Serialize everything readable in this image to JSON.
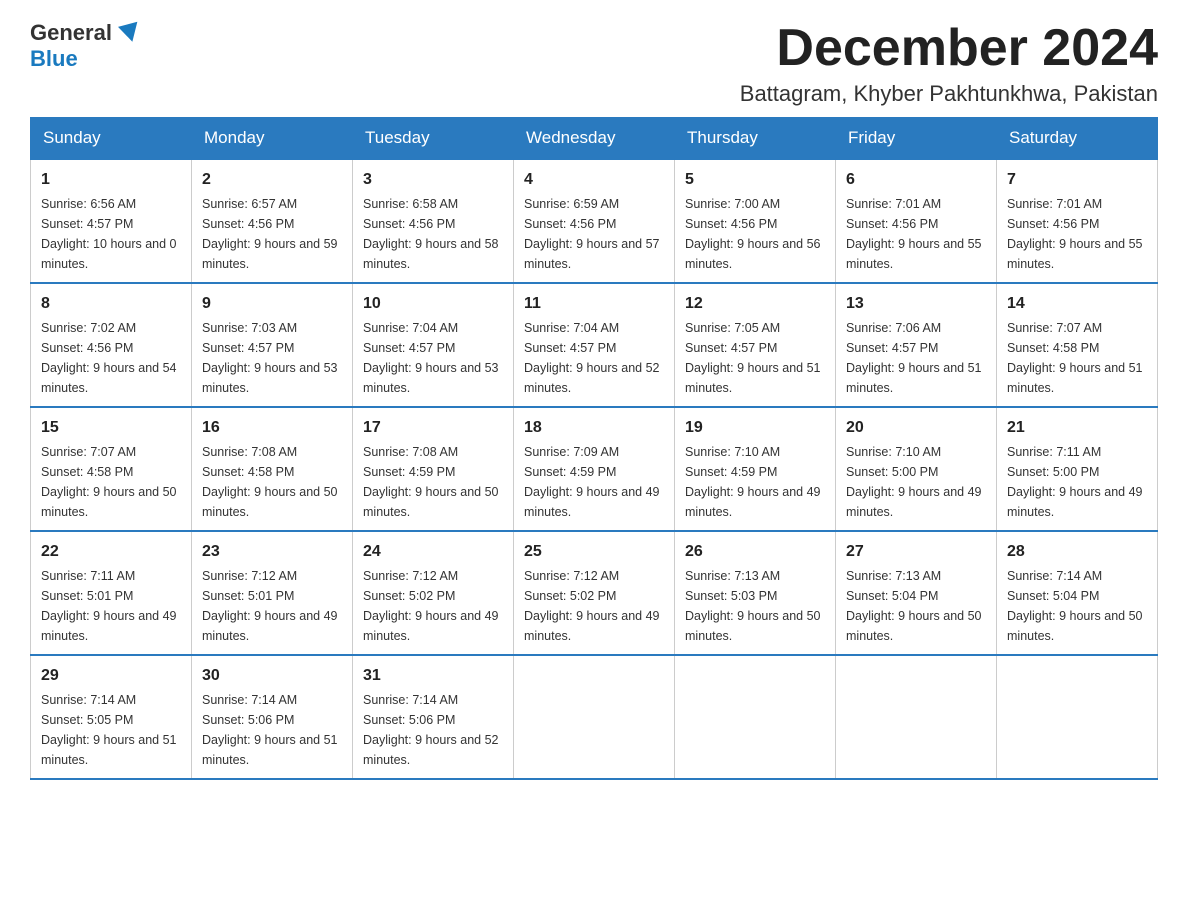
{
  "header": {
    "logo_general": "General",
    "logo_blue": "Blue",
    "title": "December 2024",
    "subtitle": "Battagram, Khyber Pakhtunkhwa, Pakistan"
  },
  "weekdays": [
    "Sunday",
    "Monday",
    "Tuesday",
    "Wednesday",
    "Thursday",
    "Friday",
    "Saturday"
  ],
  "weeks": [
    [
      {
        "day": "1",
        "sunrise": "6:56 AM",
        "sunset": "4:57 PM",
        "daylight": "10 hours and 0 minutes."
      },
      {
        "day": "2",
        "sunrise": "6:57 AM",
        "sunset": "4:56 PM",
        "daylight": "9 hours and 59 minutes."
      },
      {
        "day": "3",
        "sunrise": "6:58 AM",
        "sunset": "4:56 PM",
        "daylight": "9 hours and 58 minutes."
      },
      {
        "day": "4",
        "sunrise": "6:59 AM",
        "sunset": "4:56 PM",
        "daylight": "9 hours and 57 minutes."
      },
      {
        "day": "5",
        "sunrise": "7:00 AM",
        "sunset": "4:56 PM",
        "daylight": "9 hours and 56 minutes."
      },
      {
        "day": "6",
        "sunrise": "7:01 AM",
        "sunset": "4:56 PM",
        "daylight": "9 hours and 55 minutes."
      },
      {
        "day": "7",
        "sunrise": "7:01 AM",
        "sunset": "4:56 PM",
        "daylight": "9 hours and 55 minutes."
      }
    ],
    [
      {
        "day": "8",
        "sunrise": "7:02 AM",
        "sunset": "4:56 PM",
        "daylight": "9 hours and 54 minutes."
      },
      {
        "day": "9",
        "sunrise": "7:03 AM",
        "sunset": "4:57 PM",
        "daylight": "9 hours and 53 minutes."
      },
      {
        "day": "10",
        "sunrise": "7:04 AM",
        "sunset": "4:57 PM",
        "daylight": "9 hours and 53 minutes."
      },
      {
        "day": "11",
        "sunrise": "7:04 AM",
        "sunset": "4:57 PM",
        "daylight": "9 hours and 52 minutes."
      },
      {
        "day": "12",
        "sunrise": "7:05 AM",
        "sunset": "4:57 PM",
        "daylight": "9 hours and 51 minutes."
      },
      {
        "day": "13",
        "sunrise": "7:06 AM",
        "sunset": "4:57 PM",
        "daylight": "9 hours and 51 minutes."
      },
      {
        "day": "14",
        "sunrise": "7:07 AM",
        "sunset": "4:58 PM",
        "daylight": "9 hours and 51 minutes."
      }
    ],
    [
      {
        "day": "15",
        "sunrise": "7:07 AM",
        "sunset": "4:58 PM",
        "daylight": "9 hours and 50 minutes."
      },
      {
        "day": "16",
        "sunrise": "7:08 AM",
        "sunset": "4:58 PM",
        "daylight": "9 hours and 50 minutes."
      },
      {
        "day": "17",
        "sunrise": "7:08 AM",
        "sunset": "4:59 PM",
        "daylight": "9 hours and 50 minutes."
      },
      {
        "day": "18",
        "sunrise": "7:09 AM",
        "sunset": "4:59 PM",
        "daylight": "9 hours and 49 minutes."
      },
      {
        "day": "19",
        "sunrise": "7:10 AM",
        "sunset": "4:59 PM",
        "daylight": "9 hours and 49 minutes."
      },
      {
        "day": "20",
        "sunrise": "7:10 AM",
        "sunset": "5:00 PM",
        "daylight": "9 hours and 49 minutes."
      },
      {
        "day": "21",
        "sunrise": "7:11 AM",
        "sunset": "5:00 PM",
        "daylight": "9 hours and 49 minutes."
      }
    ],
    [
      {
        "day": "22",
        "sunrise": "7:11 AM",
        "sunset": "5:01 PM",
        "daylight": "9 hours and 49 minutes."
      },
      {
        "day": "23",
        "sunrise": "7:12 AM",
        "sunset": "5:01 PM",
        "daylight": "9 hours and 49 minutes."
      },
      {
        "day": "24",
        "sunrise": "7:12 AM",
        "sunset": "5:02 PM",
        "daylight": "9 hours and 49 minutes."
      },
      {
        "day": "25",
        "sunrise": "7:12 AM",
        "sunset": "5:02 PM",
        "daylight": "9 hours and 49 minutes."
      },
      {
        "day": "26",
        "sunrise": "7:13 AM",
        "sunset": "5:03 PM",
        "daylight": "9 hours and 50 minutes."
      },
      {
        "day": "27",
        "sunrise": "7:13 AM",
        "sunset": "5:04 PM",
        "daylight": "9 hours and 50 minutes."
      },
      {
        "day": "28",
        "sunrise": "7:14 AM",
        "sunset": "5:04 PM",
        "daylight": "9 hours and 50 minutes."
      }
    ],
    [
      {
        "day": "29",
        "sunrise": "7:14 AM",
        "sunset": "5:05 PM",
        "daylight": "9 hours and 51 minutes."
      },
      {
        "day": "30",
        "sunrise": "7:14 AM",
        "sunset": "5:06 PM",
        "daylight": "9 hours and 51 minutes."
      },
      {
        "day": "31",
        "sunrise": "7:14 AM",
        "sunset": "5:06 PM",
        "daylight": "9 hours and 52 minutes."
      },
      null,
      null,
      null,
      null
    ]
  ]
}
